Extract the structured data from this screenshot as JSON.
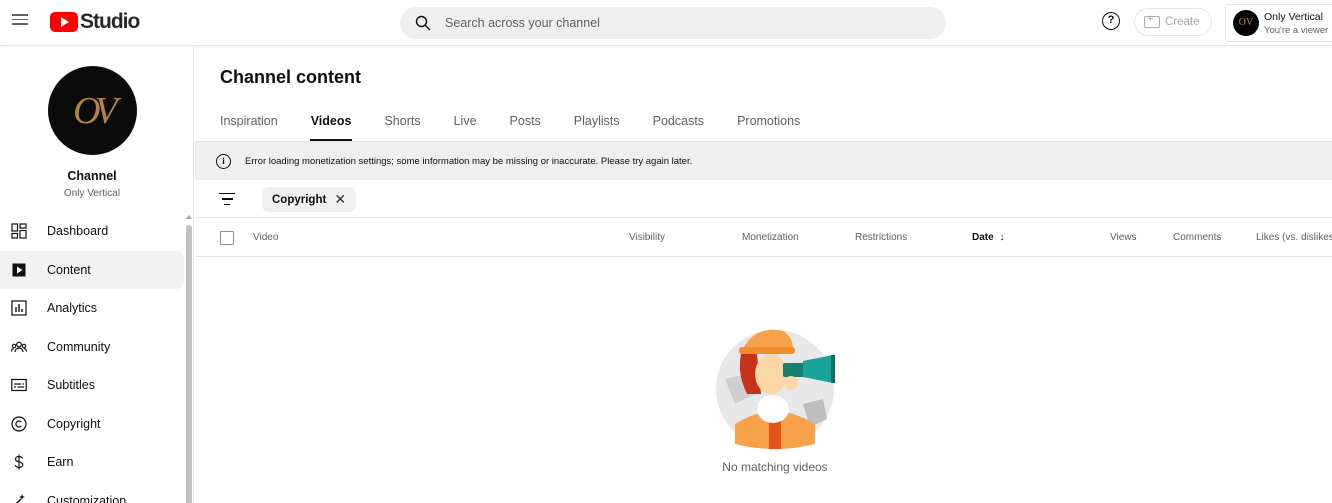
{
  "header": {
    "logo_text": "Studio",
    "search_placeholder": "Search across your channel",
    "help_label": "?",
    "create_label": "Create",
    "account_name": "Only Vertical",
    "account_role": "You're a viewer",
    "account_initials": "OV"
  },
  "sidebar": {
    "avatar_initials": "OV",
    "channel_title": "Channel",
    "channel_name": "Only Vertical",
    "items": [
      {
        "label": "Dashboard",
        "icon": "dashboard-icon"
      },
      {
        "label": "Content",
        "icon": "content-icon"
      },
      {
        "label": "Analytics",
        "icon": "analytics-icon"
      },
      {
        "label": "Community",
        "icon": "community-icon"
      },
      {
        "label": "Subtitles",
        "icon": "subtitles-icon"
      },
      {
        "label": "Copyright",
        "icon": "copyright-icon"
      },
      {
        "label": "Earn",
        "icon": "earn-icon"
      },
      {
        "label": "Customization",
        "icon": "customization-icon"
      }
    ]
  },
  "main": {
    "title": "Channel content",
    "tabs": [
      {
        "label": "Inspiration"
      },
      {
        "label": "Videos"
      },
      {
        "label": "Shorts"
      },
      {
        "label": "Live"
      },
      {
        "label": "Posts"
      },
      {
        "label": "Playlists"
      },
      {
        "label": "Podcasts"
      },
      {
        "label": "Promotions"
      }
    ],
    "active_tab": "Videos",
    "banner_message": "Error loading monetization settings; some information may be missing or inaccurate. Please try again later.",
    "filter_chip": "Copyright",
    "columns": {
      "video": "Video",
      "visibility": "Visibility",
      "monetization": "Monetization",
      "restrictions": "Restrictions",
      "date": "Date",
      "views": "Views",
      "comments": "Comments",
      "likes": "Likes (vs. dislikes)"
    },
    "empty_message": "No matching videos"
  },
  "colors": {
    "brand_red": "#ff0000",
    "accent_orange": "#f28c28",
    "accent_teal": "#1ba39c"
  }
}
